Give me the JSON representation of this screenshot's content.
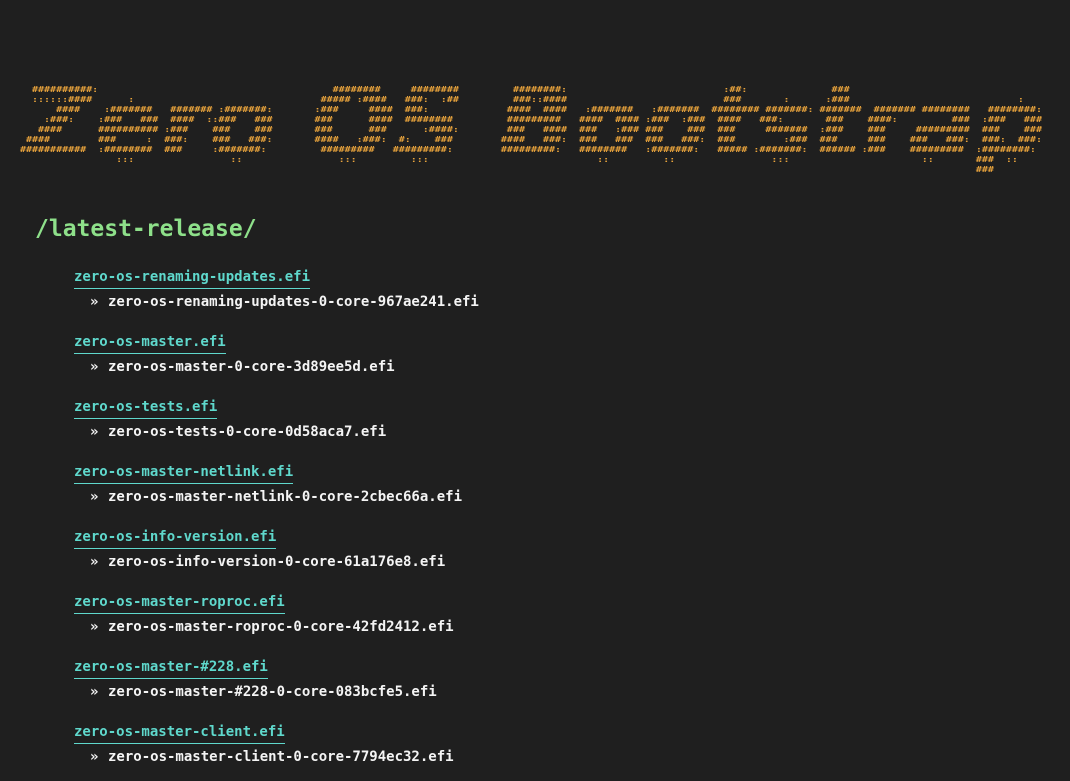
{
  "banner": {
    "text": "Zero OS Bootstrap",
    "color": "#e8a33c"
  },
  "section_title": "/latest-release/",
  "colors": {
    "background": "#1f1f1f",
    "heading": "#8ee08a",
    "link": "#5fd8cc",
    "file_text": "#f4f4f4"
  },
  "bullet": "»",
  "releases": [
    {
      "link": "zero-os-renaming-updates.efi",
      "file": "zero-os-renaming-updates-0-core-967ae241.efi"
    },
    {
      "link": "zero-os-master.efi",
      "file": "zero-os-master-0-core-3d89ee5d.efi"
    },
    {
      "link": "zero-os-tests.efi",
      "file": "zero-os-tests-0-core-0d58aca7.efi"
    },
    {
      "link": "zero-os-master-netlink.efi",
      "file": "zero-os-master-netlink-0-core-2cbec66a.efi"
    },
    {
      "link": "zero-os-info-version.efi",
      "file": "zero-os-info-version-0-core-61a176e8.efi"
    },
    {
      "link": "zero-os-master-roproc.efi",
      "file": "zero-os-master-roproc-0-core-42fd2412.efi"
    },
    {
      "link": "zero-os-master-#228.efi",
      "file": "zero-os-master-#228-0-core-083bcfe5.efi"
    },
    {
      "link": "zero-os-master-client.efi",
      "file": "zero-os-master-client-0-core-7794ec32.efi"
    }
  ]
}
